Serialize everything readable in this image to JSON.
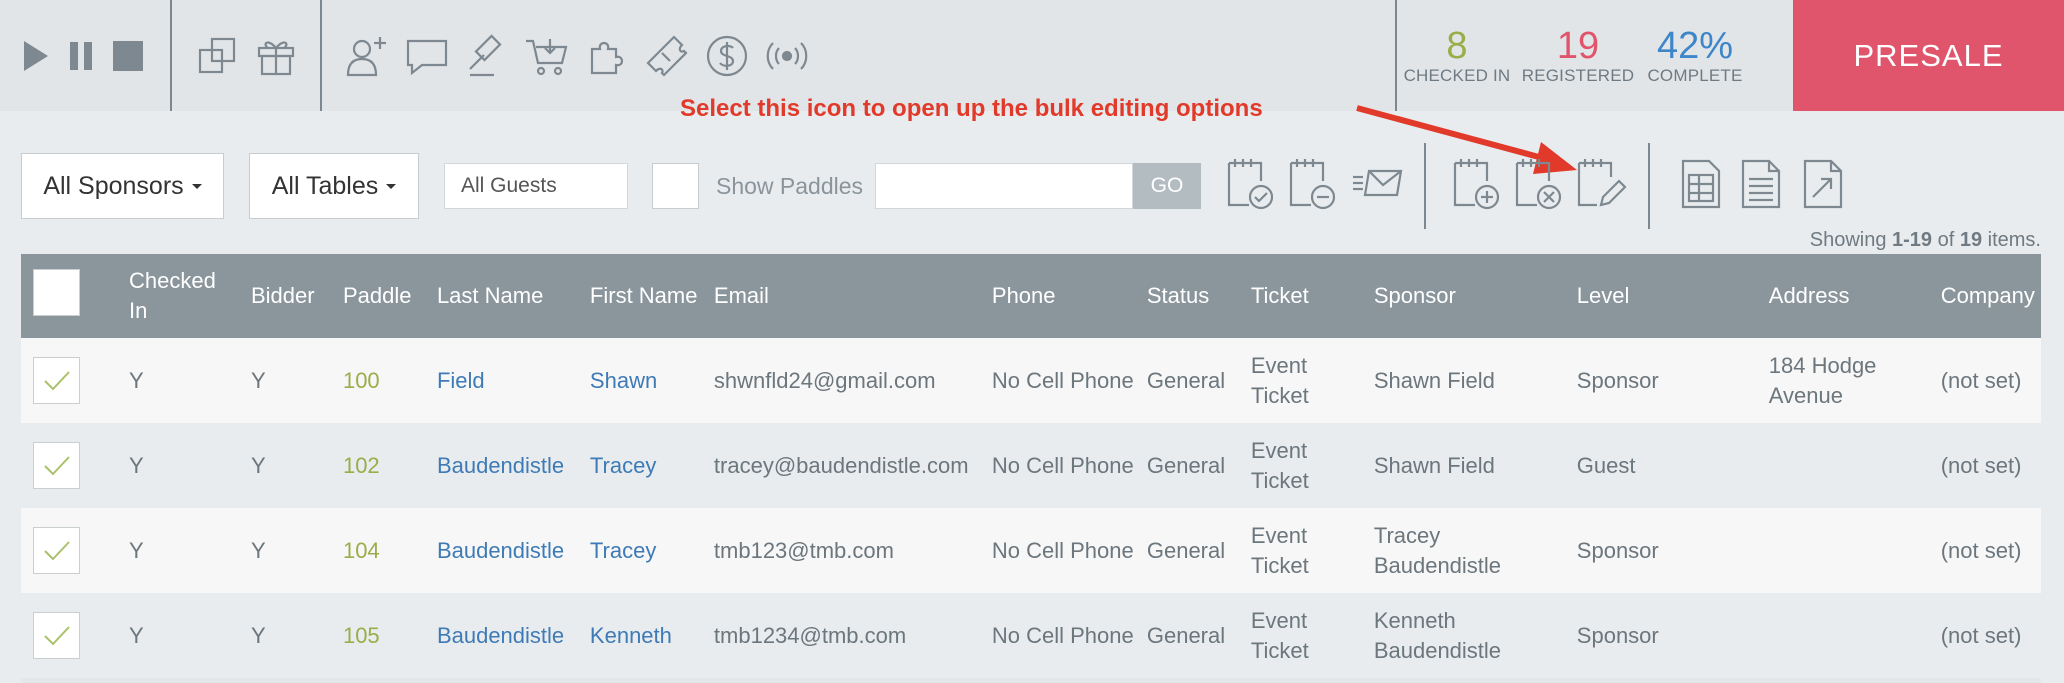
{
  "topbar": {
    "media_icons": [
      "play-icon",
      "pause-icon",
      "stop-icon"
    ],
    "group2_icons": [
      "copy-icon",
      "gift-icon"
    ],
    "group3_icons": [
      "add-user-icon",
      "chat-icon",
      "gavel-icon",
      "cart-icon",
      "puzzle-icon",
      "ticket-icon",
      "dollar-icon",
      "broadcast-icon"
    ],
    "stats": [
      {
        "value": "8",
        "label": "CHECKED IN",
        "color": "#9aad49"
      },
      {
        "value": "19",
        "label": "REGISTERED",
        "color": "#e0556c"
      },
      {
        "value": "42%",
        "label": "COMPLETE",
        "color": "#3e86c8"
      }
    ],
    "presale_label": "PRESALE"
  },
  "annotation": {
    "text": "Select this icon to open up the bulk editing options"
  },
  "filters": {
    "sponsors_label": "All Sponsors",
    "tables_label": "All Tables",
    "guests_value": "All Guests",
    "show_paddles_label": "Show Paddles",
    "search_value": "",
    "go_label": "GO"
  },
  "toolbar": {
    "icons": [
      "notepad-check-icon",
      "notepad-minus-icon",
      "send-mail-icon",
      "notepad-add-icon",
      "notepad-remove-icon",
      "notepad-edit-icon",
      "spreadsheet-icon",
      "document-icon",
      "export-icon"
    ]
  },
  "pagination": {
    "prefix": "Showing ",
    "range": "1-19",
    "middle": " of ",
    "total": "19",
    "suffix": " items."
  },
  "table": {
    "columns": [
      "",
      "Checked In",
      "Bidder",
      "Paddle",
      "Last Name",
      "First Name",
      "Email",
      "Phone",
      "Status",
      "Ticket",
      "Sponsor",
      "Level",
      "Address",
      "Company"
    ],
    "rows": [
      {
        "checked": true,
        "checked_in": "Y",
        "bidder": "Y",
        "paddle": "100",
        "last_name": "Field",
        "first_name": "Shawn",
        "email": "shwnfld24@gmail.com",
        "phone": "No Cell Phone",
        "status": "General",
        "ticket": "Event Ticket",
        "sponsor": "Shawn Field",
        "level": "Sponsor",
        "address": "184 Hodge Avenue",
        "company": "(not set)"
      },
      {
        "checked": true,
        "checked_in": "Y",
        "bidder": "Y",
        "paddle": "102",
        "last_name": "Baudendistle",
        "first_name": "Tracey",
        "email": "tracey@baudendistle.com",
        "phone": "No Cell Phone",
        "status": "General",
        "ticket": "Event Ticket",
        "sponsor": "Shawn Field",
        "level": "Guest",
        "address": "",
        "company": "(not set)"
      },
      {
        "checked": true,
        "checked_in": "Y",
        "bidder": "Y",
        "paddle": "104",
        "last_name": "Baudendistle",
        "first_name": "Tracey",
        "email": "tmb123@tmb.com",
        "phone": "No Cell Phone",
        "status": "General",
        "ticket": "Event Ticket",
        "sponsor": "Tracey Baudendistle",
        "level": "Sponsor",
        "address": "",
        "company": "(not set)"
      },
      {
        "checked": true,
        "checked_in": "Y",
        "bidder": "Y",
        "paddle": "105",
        "last_name": "Baudendistle",
        "first_name": "Kenneth",
        "email": "tmb1234@tmb.com",
        "phone": "No Cell Phone",
        "status": "General",
        "ticket": "Event Ticket",
        "sponsor": "Kenneth Baudendistle",
        "level": "Sponsor",
        "address": "",
        "company": "(not set)"
      }
    ]
  }
}
